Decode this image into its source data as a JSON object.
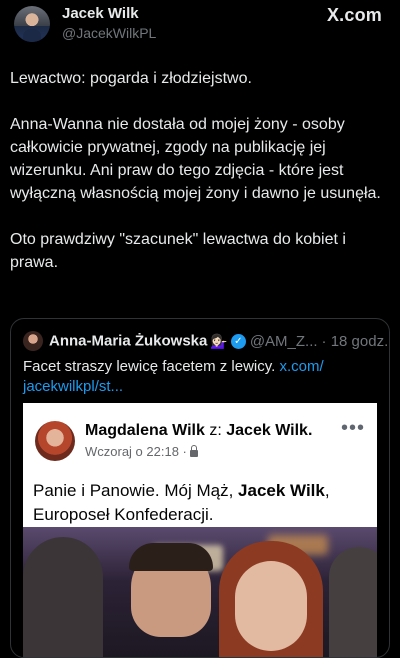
{
  "author": {
    "name": "Jacek Wilk",
    "handle": "@JacekWilkPL"
  },
  "brand": {
    "logo_text": "X.com"
  },
  "post": {
    "paragraphs": [
      "Lewactwo: pogarda i złodziejstwo.",
      "Anna-Wanna nie dostała od mojej żony - osoby całkowicie prywatnej, zgody na publikację jej wizerunku. Ani praw do tego zdjęcia - które jest wyłączną własnością mojej żony i dawno je usunęła.",
      "Oto prawdziwy \"szacunek\" lewactwa do kobiet i prawa."
    ]
  },
  "quote": {
    "author_name": "Anna-Maria Żukowska",
    "author_emoji": "💁🏻‍♀️",
    "handle": "@AM_Z...",
    "time": "· 18 godz.",
    "text": "Facet straszy lewicę facetem z lewicy.",
    "link": "x.com/\njacekwilkpl/st...",
    "link_line1": "x.com/",
    "link_line2": "jacekwilkpl/st..."
  },
  "facebook_post": {
    "author": "Magdalena Wilk",
    "connector": "z:",
    "tagged": "Jacek Wilk.",
    "time": "Wczoraj o 22:18 ·",
    "text_before": "Panie i Panowie. Mój Mąż, ",
    "text_bold": "Jacek Wilk",
    "text_after": ", Europoseł Konfederacji.",
    "menu_glyph": "•••"
  },
  "colors": {
    "background": "#000000",
    "text": "#e7e9ea",
    "muted": "#71767b",
    "link": "#1d9bf0",
    "border": "#2f3336"
  }
}
